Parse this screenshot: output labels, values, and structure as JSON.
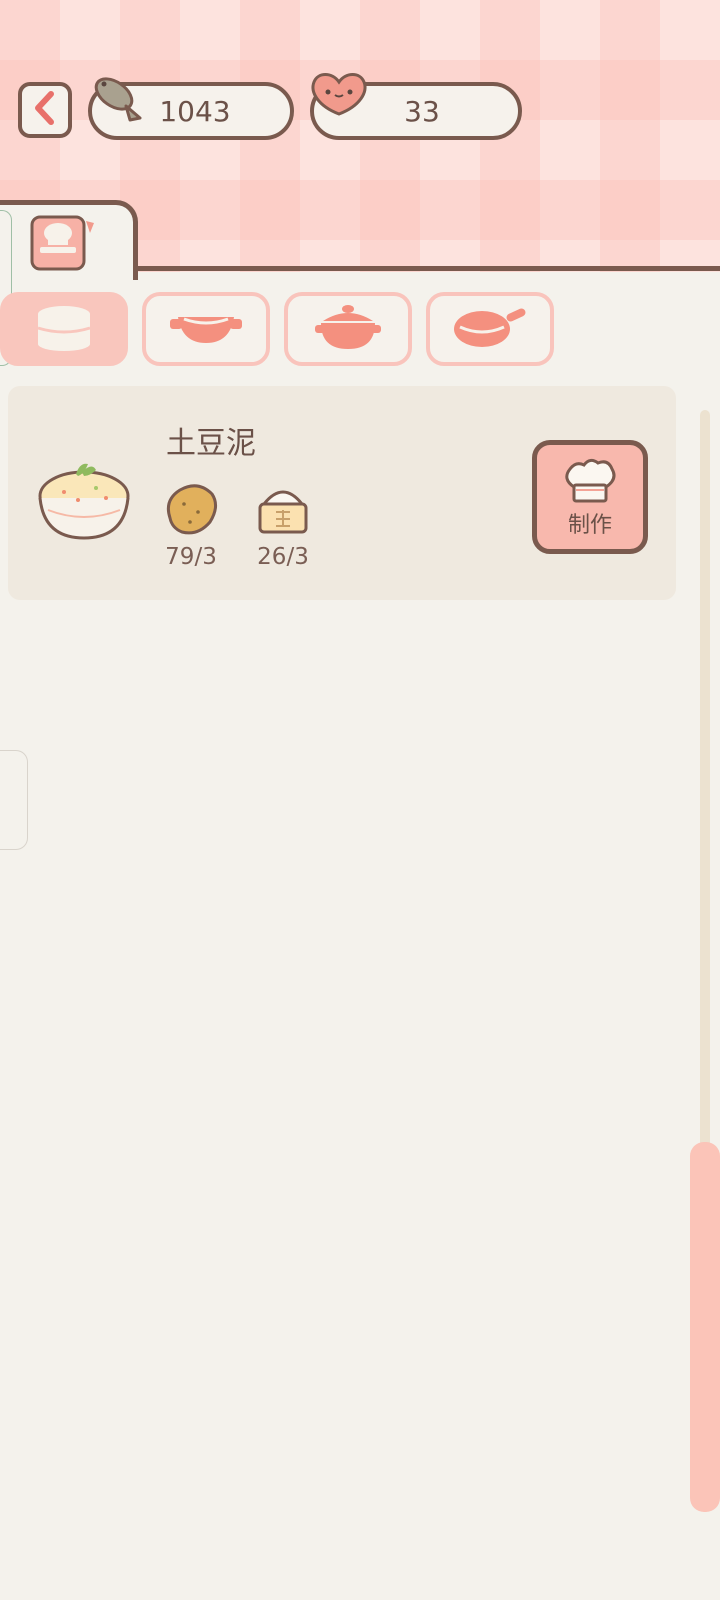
{
  "currency": {
    "fish_icon": "fish-icon",
    "fish_value": "1043",
    "heart_icon": "heart-icon",
    "heart_value": "33"
  },
  "tabs": [
    {
      "icon": "recipe-book-icon",
      "active": true
    }
  ],
  "categories": [
    {
      "icon": "steamer-icon",
      "active": true
    },
    {
      "icon": "wok-icon",
      "active": false
    },
    {
      "icon": "pot-icon",
      "active": false
    },
    {
      "icon": "frying-pan-icon",
      "active": false
    }
  ],
  "recipe": {
    "name": "土豆泥",
    "image": "mashed-potato-bowl",
    "ingredients": [
      {
        "icon": "potato-icon",
        "qty": "79/3"
      },
      {
        "icon": "flour-icon",
        "qty": "26/3"
      }
    ],
    "make_label": "制作"
  },
  "colors": {
    "accent": "#f8b8ad",
    "outline": "#7a5a4e",
    "background": "#f4f2ec",
    "card": "#efe9df"
  }
}
